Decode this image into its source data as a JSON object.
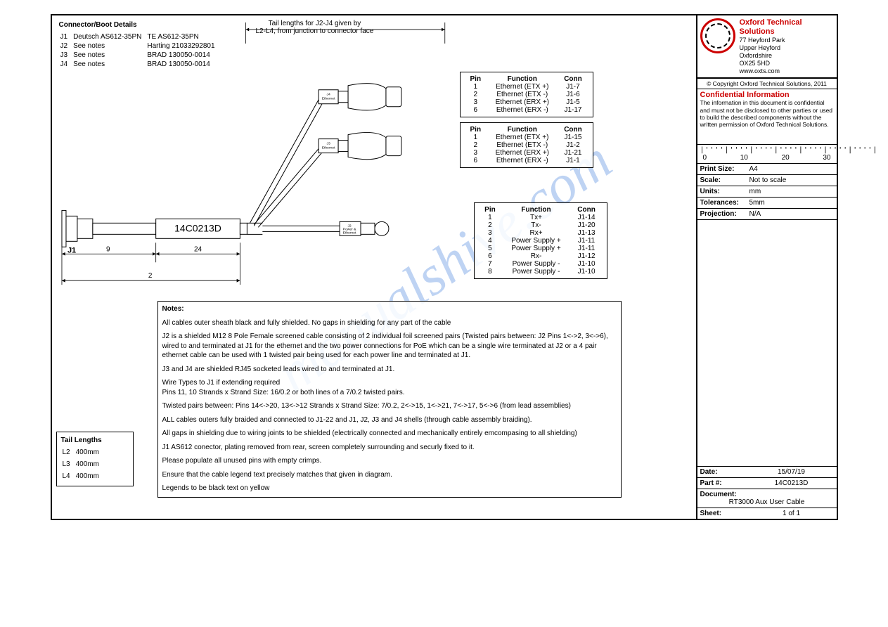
{
  "company": {
    "name": "Oxford Technical Solutions",
    "addr1": "77 Heyford Park",
    "addr2": "Upper Heyford",
    "addr3": "Oxfordshire",
    "addr4": "OX25 5HD",
    "web": "www.oxts.com",
    "copyright": "© Copyright Oxford Technical Solutions, 2011"
  },
  "confidential": {
    "title": "Confidential Information",
    "text": "The information in this document is confidential and must not be disclosed to other parties or used to build the described components without the written permission of Oxford Technical Solutions."
  },
  "meta": {
    "print_size_label": "Print Size:",
    "print_size": "A4",
    "scale_label": "Scale:",
    "scale": "Not to scale",
    "units_label": "Units:",
    "units": "mm",
    "tol_label": "Tolerances:",
    "tol": "5mm",
    "proj_label": "Projection:",
    "proj": "N/A",
    "date_label": "Date:",
    "date": "15/07/19",
    "part_label": "Part #:",
    "part": "14C0213D",
    "doc_label": "Document:",
    "doc": "RT3000 Aux User Cable",
    "sheet_label": "Sheet:",
    "sheet": "1 of 1"
  },
  "ruler": {
    "ticks": "|''''|''''|''''|''''|''''|''''|''''|",
    "0": "0",
    "10": "10",
    "20": "20",
    "30": "30"
  },
  "connector_details": {
    "title": "Connector/Boot Details",
    "rows": [
      {
        "ref": "J1",
        "desc": "Deutsch AS612-35PN",
        "pn": "TE AS612-35PN"
      },
      {
        "ref": "J2",
        "desc": "See notes",
        "pn": "Harting 21033292801"
      },
      {
        "ref": "J3",
        "desc": "See notes",
        "pn": "BRAD 130050-0014"
      },
      {
        "ref": "J4",
        "desc": "See notes",
        "pn": "BRAD 130050-0014"
      }
    ]
  },
  "tail_note": {
    "l1": "Tail lengths for J2-J4 given by",
    "l2": "L2-L4, from junction to connector face"
  },
  "pinouts": {
    "hdr_pin": "Pin",
    "hdr_func": "Function",
    "hdr_conn": "Conn",
    "j4": [
      {
        "pin": "1",
        "func": "Ethernet (ETX +)",
        "conn": "J1-7"
      },
      {
        "pin": "2",
        "func": "Ethernet (ETX -)",
        "conn": "J1-6"
      },
      {
        "pin": "3",
        "func": "Ethernet (ERX +)",
        "conn": "J1-5"
      },
      {
        "pin": "6",
        "func": "Ethernet (ERX -)",
        "conn": "J1-17"
      }
    ],
    "j3": [
      {
        "pin": "1",
        "func": "Ethernet (ETX +)",
        "conn": "J1-15"
      },
      {
        "pin": "2",
        "func": "Ethernet (ETX -)",
        "conn": "J1-2"
      },
      {
        "pin": "3",
        "func": "Ethernet (ERX +)",
        "conn": "J1-21"
      },
      {
        "pin": "6",
        "func": "Ethernet (ERX -)",
        "conn": "J1-1"
      }
    ],
    "j2": [
      {
        "pin": "1",
        "func": "Tx+",
        "conn": "J1-14"
      },
      {
        "pin": "2",
        "func": "Tx-",
        "conn": "J1-20"
      },
      {
        "pin": "3",
        "func": "Rx+",
        "conn": "J1-13"
      },
      {
        "pin": "4",
        "func": "Power Supply +",
        "conn": "J1-11"
      },
      {
        "pin": "5",
        "func": "Power Supply +",
        "conn": "J1-11"
      },
      {
        "pin": "6",
        "func": "Rx-",
        "conn": "J1-12"
      },
      {
        "pin": "7",
        "func": "Power Supply -",
        "conn": "J1-10"
      },
      {
        "pin": "8",
        "func": "Power Supply -",
        "conn": "J1-10"
      }
    ]
  },
  "tail_lengths": {
    "title": "Tail Lengths",
    "rows": [
      {
        "ref": "L2",
        "val": "400mm"
      },
      {
        "ref": "L3",
        "val": "400mm"
      },
      {
        "ref": "L4",
        "val": "400mm"
      }
    ]
  },
  "diagram": {
    "cable_label": "14C0213D",
    "j1_label": "J1",
    "dim9": "9",
    "dim24": "24",
    "dim2": "2",
    "j2_lbl1": "J2",
    "j2_lbl2": "Power &",
    "j2_lbl3": "Ethernet",
    "j3_lbl1": "J3",
    "j3_lbl2": "Ethernet",
    "j4_lbl1": "J4",
    "j4_lbl2": "Ethernet"
  },
  "notes": {
    "title": "Notes:",
    "items": [
      "All cables outer sheath black and fully shielded. No gaps in shielding for any part of the cable",
      "J2 is a shielded M12 8 Pole Female screened cable consisting of 2 individual foil screened pairs (Twisted pairs between: J2 Pins 1<->2, 3<->6), wired to and terminated at J1 for the ethernet and the two power connections for PoE which can be a single wire terminated at J2 or a 4 pair ethernet cable can be used with 1 twisted pair being used for each power line and terminated at J1.",
      "J3 and J4 are shielded RJ45 socketed leads wired to and terminated at J1.",
      "Wire Types to J1 if extending required\nPins 11, 10 Strands x Strand Size: 16/0.2 or both lines of a 7/0.2 twisted pairs.",
      "Twisted pairs between: Pins 14<->20, 13<->12 Strands x Strand Size: 7/0.2, 2<->15, 1<->21, 7<->17, 5<->6 (from lead assemblies)",
      "ALL cables outers fully braided and connected to J1-22 and J1, J2, J3 and J4 shells (through cable assembly braiding).",
      "All gaps in shielding due to wiring joints to be shielded (electrically connected and mechanically entirely emcompasing to all shielding)",
      "J1 AS612 conector, plating removed from rear, screen completely surrounding and securly fixed to it.",
      "Please populate all unused pins with empty crimps.",
      "Ensure that the cable legend text precisely matches that given in diagram.",
      "Legends to be black text on yellow"
    ]
  },
  "watermark": "manualshive.com"
}
